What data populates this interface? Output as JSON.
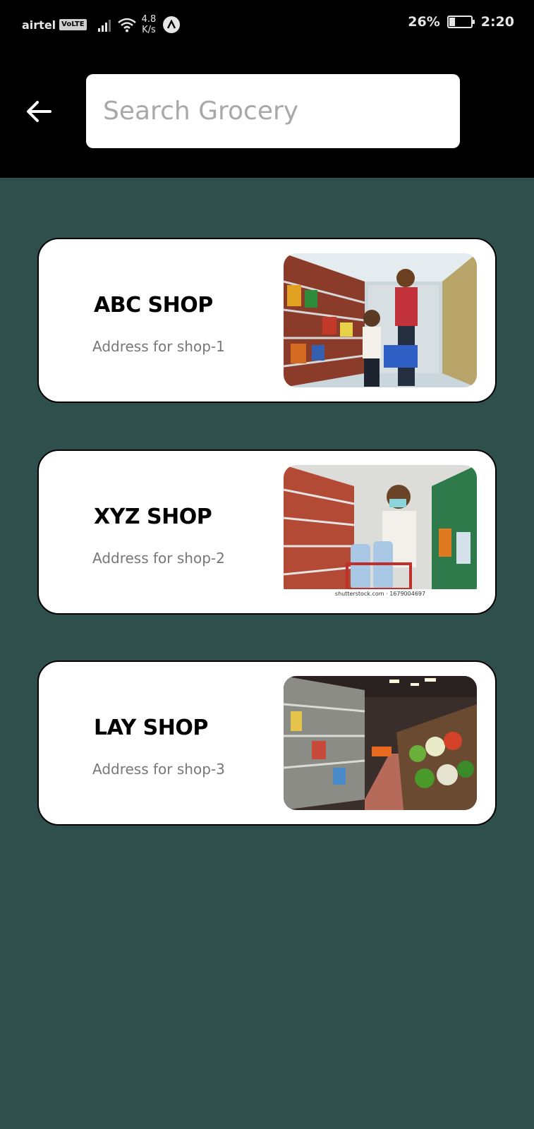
{
  "status_bar": {
    "carrier": "airtel",
    "network_badge": "VoLTE",
    "speed_value": "4.8",
    "speed_unit": "K/s",
    "battery_percent": "26%",
    "battery_level": 0.26,
    "time": "2:20"
  },
  "header": {
    "back_icon": "arrow-left-icon",
    "search_placeholder": "Search Grocery"
  },
  "shops": [
    {
      "name": "ABC SHOP",
      "address": "Address for shop-1",
      "image": "supermarket-aisle-photo"
    },
    {
      "name": "XYZ SHOP",
      "address": "Address for shop-2",
      "image": "masked-shopper-photo",
      "watermark": "shutterstock.com · 1679004697"
    },
    {
      "name": "LAY SHOP",
      "address": "Address for shop-3",
      "image": "produce-aisle-photo"
    }
  ],
  "colors": {
    "background": "#2f4f4d",
    "app_bar": "#000000",
    "card": "#ffffff",
    "address_text": "#777777"
  }
}
